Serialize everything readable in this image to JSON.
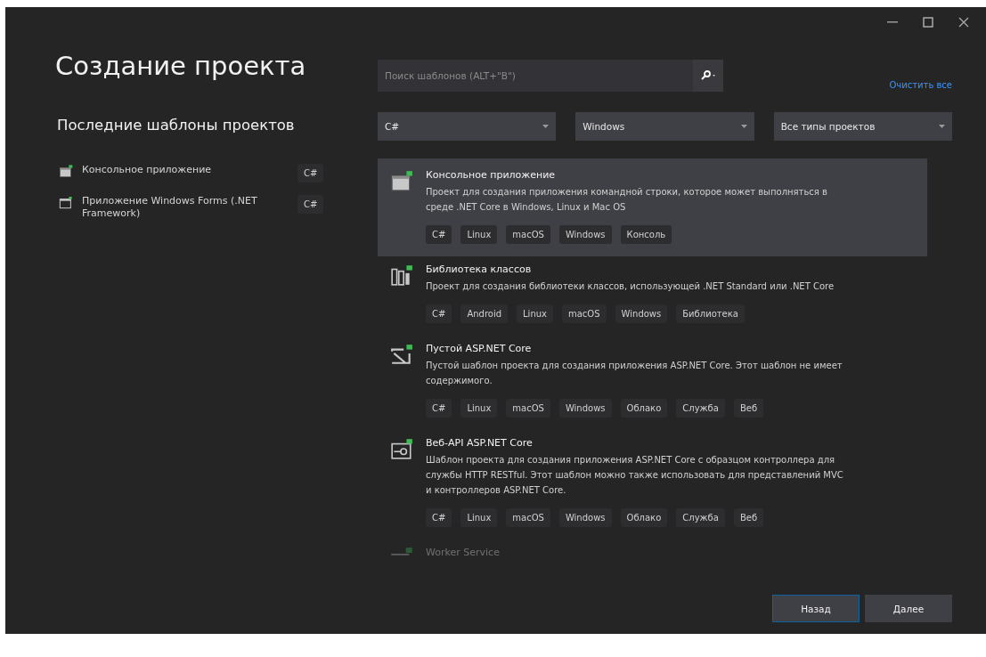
{
  "title": "Создание проекта",
  "recent": {
    "heading": "Последние шаблоны проектов",
    "items": [
      {
        "name": "Консольное приложение",
        "kind": "console",
        "tag": "C#"
      },
      {
        "name": "Приложение Windows Forms (.NET Framework)",
        "kind": "forms",
        "tag": "C#"
      }
    ]
  },
  "search": {
    "placeholder": "Поиск шаблонов (ALT+\"В\")"
  },
  "clear_link": "Очистить все",
  "filters": [
    {
      "value": "C#"
    },
    {
      "value": "Windows"
    },
    {
      "value": "Все типы проектов"
    }
  ],
  "templates": [
    {
      "kind": "console",
      "selected": true,
      "name": "Консольное приложение",
      "description": "Проект для создания приложения командной строки, которое может выполняться в среде .NET Core в Windows, Linux и Mac OS",
      "tags": [
        "C#",
        "Linux",
        "macOS",
        "Windows",
        "Консоль"
      ]
    },
    {
      "kind": "library",
      "selected": false,
      "name": "Библиотека классов",
      "description": "Проект для создания библиотеки классов, использующей .NET Standard или .NET Core",
      "tags": [
        "C#",
        "Android",
        "Linux",
        "macOS",
        "Windows",
        "Библиотека"
      ]
    },
    {
      "kind": "web-empty",
      "selected": false,
      "name": "Пустой ASP.NET Core",
      "description": "Пустой шаблон проекта для создания приложения ASP.NET Core. Этот шаблон не имеет содержимого.",
      "tags": [
        "C#",
        "Linux",
        "macOS",
        "Windows",
        "Облако",
        "Служба",
        "Веб"
      ]
    },
    {
      "kind": "web-api",
      "selected": false,
      "name": "Веб-API ASP.NET Core",
      "description": "Шаблон проекта для создания приложения ASP.NET Core с образцом контроллера для службы HTTP RESTful. Этот шаблон можно также использовать для представлений MVC и контроллеров ASP.NET Core.",
      "tags": [
        "C#",
        "Linux",
        "macOS",
        "Windows",
        "Облако",
        "Служба",
        "Веб"
      ]
    },
    {
      "kind": "worker",
      "selected": false,
      "name": "Worker Service",
      "faded": true
    }
  ],
  "buttons": [
    {
      "label": "Назад",
      "focused": true
    },
    {
      "label": "Далее",
      "focused": false
    }
  ]
}
